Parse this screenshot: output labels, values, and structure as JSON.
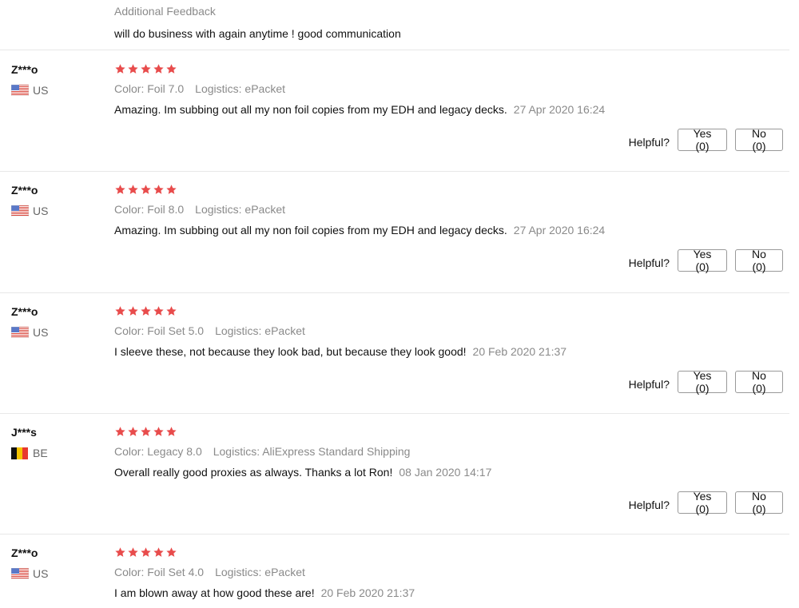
{
  "top_feedback": {
    "label": "Additional Feedback",
    "text": "will do business with again anytime ! good communication"
  },
  "colors": {
    "star": "#e84c4c",
    "meta": "#8a8a8a",
    "divider": "#e8e8e8"
  },
  "helpful_label": "Helpful?",
  "reviews": [
    {
      "user": "Z***o",
      "country": "US",
      "flag_icon": "us-flag-icon",
      "rating": 5,
      "color_label": "Color: Foil 7.0",
      "logistics": "Logistics: ePacket",
      "text": "Amazing. Im subbing out all my non foil copies from my EDH and legacy decks.",
      "date": "27 Apr 2020 16:24",
      "yes": "Yes (0)",
      "no": "No (0)"
    },
    {
      "user": "Z***o",
      "country": "US",
      "flag_icon": "us-flag-icon",
      "rating": 5,
      "color_label": "Color: Foil 8.0",
      "logistics": "Logistics: ePacket",
      "text": "Amazing. Im subbing out all my non foil copies from my EDH and legacy decks.",
      "date": "27 Apr 2020 16:24",
      "yes": "Yes (0)",
      "no": "No (0)"
    },
    {
      "user": "Z***o",
      "country": "US",
      "flag_icon": "us-flag-icon",
      "rating": 5,
      "color_label": "Color: Foil Set 5.0",
      "logistics": "Logistics: ePacket",
      "text": "I sleeve these, not because they look bad, but because they look good!",
      "date": "20 Feb 2020 21:37",
      "yes": "Yes (0)",
      "no": "No (0)"
    },
    {
      "user": "J***s",
      "country": "BE",
      "flag_icon": "be-flag-icon",
      "rating": 5,
      "color_label": "Color: Legacy 8.0",
      "logistics": "Logistics: AliExpress Standard Shipping",
      "text": "Overall really good proxies as always. Thanks a lot Ron!",
      "date": "08 Jan 2020 14:17",
      "yes": "Yes (0)",
      "no": "No (0)"
    },
    {
      "user": "Z***o",
      "country": "US",
      "flag_icon": "us-flag-icon",
      "rating": 5,
      "color_label": "Color: Foil Set 4.0",
      "logistics": "Logistics: ePacket",
      "text": "I am blown away at how good these are!",
      "date": "20 Feb 2020 21:37"
    }
  ]
}
